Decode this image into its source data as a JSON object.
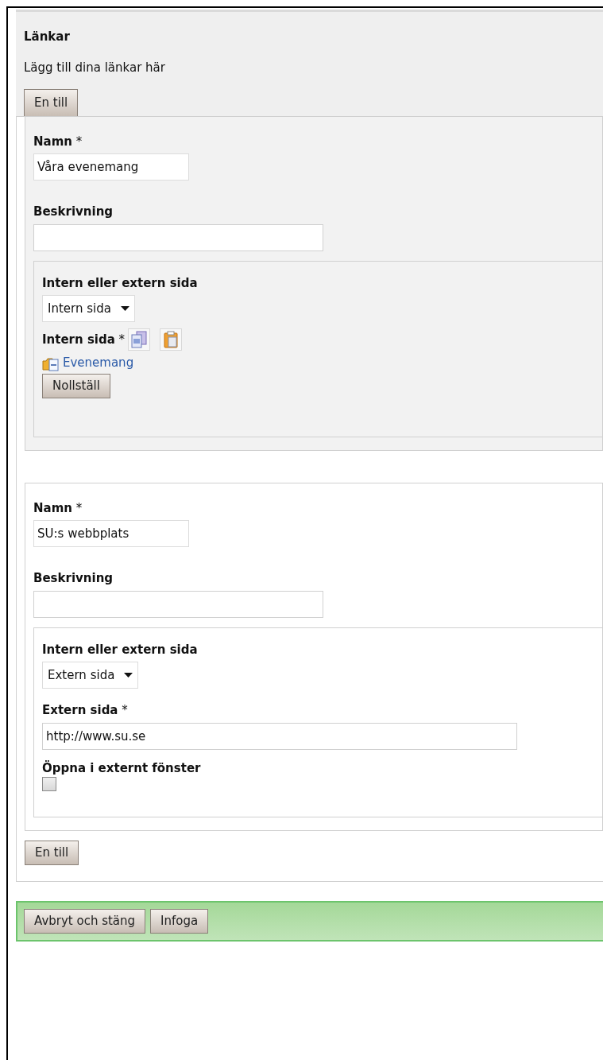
{
  "section": {
    "title": "Länkar",
    "description": "Lägg till dina länkar här"
  },
  "add_button_top": "En till",
  "links": [
    {
      "kind": "internal",
      "name_label": "**Namn** *",
      "name_value": "Våra evenemang",
      "desc_label": "Beskrivning",
      "type_label": "Intern eller extern sida",
      "type_value": "Intern sida",
      "page_label": "**Intern sida** *",
      "page_link": "Evenemang",
      "reset_button": "Nollställ"
    },
    {
      "kind": "external",
      "name_label": "**Namn** *",
      "name_value": "SU:s webbplats",
      "desc_label": "Beskrivning",
      "type_label": "Intern eller extern sida",
      "type_value": "Extern sida",
      "url_label": "**Extern sida** *",
      "url_value": "http://www.su.se",
      "new_window_label": "Öppna i externt fönster",
      "new_window_checked": false
    }
  ],
  "add_button_bottom": "En till",
  "footer_buttons": [
    "Avbryt och stäng",
    "Infoga"
  ]
}
